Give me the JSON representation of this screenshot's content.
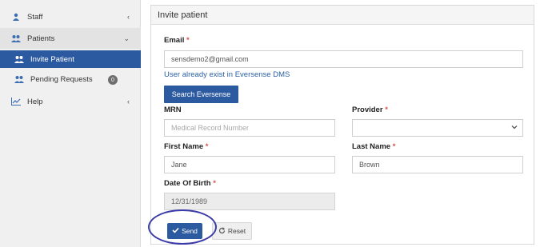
{
  "sidebar": {
    "items": [
      {
        "label": "Staff",
        "icon": "person-icon",
        "chevron": "‹"
      },
      {
        "label": "Patients",
        "icon": "users-icon",
        "chevron": "⌄"
      },
      {
        "label": "Invite Patient",
        "icon": "users-icon"
      },
      {
        "label": "Pending Requests",
        "icon": "users-icon",
        "badge": "0"
      },
      {
        "label": "Help",
        "icon": "chart-icon",
        "chevron": "‹"
      }
    ]
  },
  "panel": {
    "title": "Invite patient",
    "email": {
      "label": "Email",
      "required": "*",
      "value": "sensdemo2@gmail.com"
    },
    "exists_message": "User already exist in Eversense DMS",
    "search_button": "Search Eversense",
    "mrn": {
      "label": "MRN",
      "placeholder": "Medical Record Number"
    },
    "provider": {
      "label": "Provider",
      "required": "*",
      "value": ""
    },
    "first_name": {
      "label": "First Name",
      "required": "*",
      "value": "Jane"
    },
    "last_name": {
      "label": "Last Name",
      "required": "*",
      "value": "Brown"
    },
    "dob": {
      "label": "Date Of Birth",
      "required": "*",
      "value": "12/31/1989"
    },
    "send_button": "Send",
    "reset_button": "Reset"
  },
  "colors": {
    "accent": "#2c5aa0",
    "required": "#d9534f",
    "info": "#2a5fa5",
    "annotation": "#3a3aa8"
  }
}
